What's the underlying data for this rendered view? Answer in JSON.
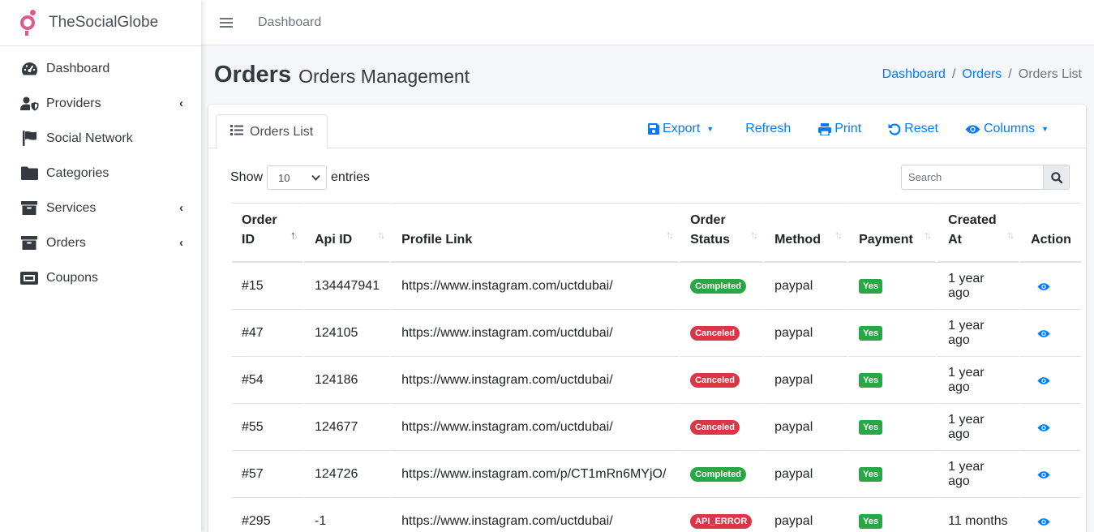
{
  "brand": {
    "name": "TheSocialGlobe",
    "color": "#e05a8a"
  },
  "sidebar": {
    "items": [
      {
        "label": "Dashboard",
        "icon": "tachometer-icon",
        "has_caret": false
      },
      {
        "label": "Providers",
        "icon": "user-shield-icon",
        "has_caret": true
      },
      {
        "label": "Social Network",
        "icon": "flag-icon",
        "has_caret": false
      },
      {
        "label": "Categories",
        "icon": "folder-icon",
        "has_caret": false
      },
      {
        "label": "Services",
        "icon": "archive-icon",
        "has_caret": true
      },
      {
        "label": "Orders",
        "icon": "archive-icon",
        "has_caret": true
      },
      {
        "label": "Coupons",
        "icon": "ticket-icon",
        "has_caret": false
      }
    ]
  },
  "topbar": {
    "link": "Dashboard"
  },
  "header": {
    "title": "Orders",
    "subtitle": "Orders Management",
    "breadcrumb": [
      "Dashboard",
      "Orders",
      "Orders List"
    ]
  },
  "card": {
    "tab_label": "Orders List",
    "tools": {
      "export": "Export",
      "refresh": "Refresh",
      "print": "Print",
      "reset": "Reset",
      "columns": "Columns"
    },
    "length": {
      "show": "Show",
      "value": "10",
      "entries": "entries"
    },
    "search_placeholder": "Search"
  },
  "table": {
    "columns": [
      "Order ID",
      "Api ID",
      "Profile Link",
      "Order Status",
      "Method",
      "Payment",
      "Created At",
      "Action"
    ],
    "rows": [
      {
        "id": "#15",
        "api": "134447941",
        "link": "https://www.instagram.com/uctdubai/",
        "status": "Completed",
        "status_color": "green",
        "method": "paypal",
        "payment": "Yes",
        "created": "1 year ago"
      },
      {
        "id": "#47",
        "api": "124105",
        "link": "https://www.instagram.com/uctdubai/",
        "status": "Canceled",
        "status_color": "red",
        "method": "paypal",
        "payment": "Yes",
        "created": "1 year ago"
      },
      {
        "id": "#54",
        "api": "124186",
        "link": "https://www.instagram.com/uctdubai/",
        "status": "Canceled",
        "status_color": "red",
        "method": "paypal",
        "payment": "Yes",
        "created": "1 year ago"
      },
      {
        "id": "#55",
        "api": "124677",
        "link": "https://www.instagram.com/uctdubai/",
        "status": "Canceled",
        "status_color": "red",
        "method": "paypal",
        "payment": "Yes",
        "created": "1 year ago"
      },
      {
        "id": "#57",
        "api": "124726",
        "link": "https://www.instagram.com/p/CT1mRn6MYjO/",
        "status": "Completed",
        "status_color": "green",
        "method": "paypal",
        "payment": "Yes",
        "created": "1 year ago"
      },
      {
        "id": "#295",
        "api": "-1",
        "link": "https://www.instagram.com/uctdubai/",
        "status": "API_ERROR",
        "status_color": "red",
        "method": "paypal",
        "payment": "Yes",
        "created": "11 months"
      }
    ]
  },
  "colors": {
    "link": "#007bff",
    "success": "#28a745",
    "danger": "#dc3545"
  }
}
